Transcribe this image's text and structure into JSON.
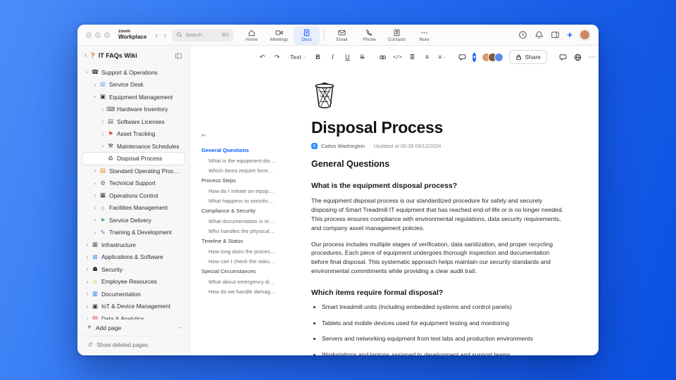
{
  "theme": {
    "accent": "#0b5cff"
  },
  "titlebar": {
    "brand_top": "zoom",
    "brand_bottom": "Workplace",
    "search": {
      "placeholder": "Search",
      "shortcut": "⌘F"
    },
    "user_avatar_color": "#c98a5e",
    "nav_tabs": [
      {
        "label": "Home",
        "icon": "home-icon",
        "active": false
      },
      {
        "label": "Meetings",
        "icon": "video-icon",
        "active": false
      },
      {
        "label": "Docs",
        "icon": "docs-icon",
        "active": true
      },
      {
        "label": "Email",
        "icon": "email-icon",
        "active": false
      },
      {
        "label": "Phone",
        "icon": "phone-icon",
        "active": false
      },
      {
        "label": "Contacts",
        "icon": "contacts-icon",
        "active": false
      },
      {
        "label": "More",
        "icon": "more-icon",
        "active": false
      }
    ]
  },
  "sidebar": {
    "title": "IT FAQs Wiki",
    "tree": [
      {
        "label": "Support & Operations",
        "icon": "phone-handset-icon",
        "level": 0,
        "expanded": true
      },
      {
        "label": "Service Desk",
        "icon": "service-desk-icon",
        "level": 1
      },
      {
        "label": "Equipment Management",
        "icon": "equipment-icon",
        "level": 1,
        "expanded": true
      },
      {
        "label": "Hardware Inventory",
        "icon": "hardware-icon",
        "level": 2
      },
      {
        "label": "Software Licenses",
        "icon": "license-icon",
        "level": 2
      },
      {
        "label": "Asset Tracking",
        "icon": "asset-pin-icon",
        "level": 2
      },
      {
        "label": "Maintenance Schedules",
        "icon": "maintenance-icon",
        "level": 2
      },
      {
        "label": "Disposal Process",
        "icon": "trash-icon",
        "level": 2,
        "selected": true,
        "leaf": true
      },
      {
        "label": "Standard Operating Procedures",
        "icon": "sop-book-icon",
        "level": 1
      },
      {
        "label": "Technical Support",
        "icon": "gear-icon",
        "level": 1
      },
      {
        "label": "Operations Control",
        "icon": "control-icon",
        "level": 1
      },
      {
        "label": "Facilities Management",
        "icon": "building-icon",
        "level": 1
      },
      {
        "label": "Service Delivery",
        "icon": "delivery-icon",
        "level": 1
      },
      {
        "label": "Training & Development",
        "icon": "training-icon",
        "level": 1
      },
      {
        "label": "Infrastructure",
        "icon": "server-icon",
        "level": 0
      },
      {
        "label": "Applications & Software",
        "icon": "apps-icon",
        "level": 0
      },
      {
        "label": "Security",
        "icon": "shield-icon",
        "level": 0
      },
      {
        "label": "Employee Resources",
        "icon": "people-icon",
        "level": 0
      },
      {
        "label": "Documentation",
        "icon": "documentation-icon",
        "level": 0
      },
      {
        "label": "IoT & Device Management",
        "icon": "device-icon",
        "level": 0
      },
      {
        "label": "Data & Analytics",
        "icon": "analytics-icon",
        "level": 0
      }
    ],
    "add_page": "Add page",
    "show_deleted": "Show deleted pages"
  },
  "toolbar": {
    "text_style": "Text",
    "share_label": "Share",
    "avatars": [
      "#d99a6c",
      "#7a5b45",
      "#5b8def"
    ]
  },
  "outline": {
    "sections": [
      {
        "title": "General Questions",
        "active": true,
        "items": [
          "What is the equipment disp...",
          "Which items require formal ..."
        ]
      },
      {
        "title": "Process Steps",
        "active": false,
        "items": [
          "How do I initiate an equipm...",
          "What happens to sensitive ..."
        ]
      },
      {
        "title": "Compliance & Security",
        "active": false,
        "items": [
          "What documentation is req...",
          "Who handles the physical di..."
        ]
      },
      {
        "title": "Timeline & Status",
        "active": false,
        "items": [
          "How long does the process ...",
          "How can I check the status ..."
        ]
      },
      {
        "title": "Special Circumstances",
        "active": false,
        "items": [
          "What about emergency dis...",
          "How do we handle damage..."
        ]
      }
    ]
  },
  "doc": {
    "title": "Disposal Process",
    "author": "Carlos Washington",
    "updated": "Updated at 00:39 09/12/2024",
    "section_heading": "General Questions",
    "qa": [
      {
        "question": "What is the equipment disposal process?",
        "paragraphs": [
          "The equipment disposal process is our standardized procedure for safely and securely disposing of Smart Treadmill IT equipment that has reached end-of-life or is no longer needed. This process ensures compliance with environmental regulations, data security requirements, and company asset management policies.",
          "Our process includes multiple stages of verification, data sanitization, and proper recycling procedures. Each piece of equipment undergoes thorough inspection and documentation before final disposal. This systematic approach helps maintain our security standards and environmental commitments while providing a clear audit trail."
        ]
      },
      {
        "question": "Which items require formal disposal?",
        "bullets": [
          "Smart treadmill units (including embedded systems and control panels)",
          "Tablets and mobile devices used for equipment testing and monitoring",
          "Servers and networking equipment from test labs and production environments",
          "Workstations and laptops assigned to development and support teams"
        ]
      }
    ]
  }
}
